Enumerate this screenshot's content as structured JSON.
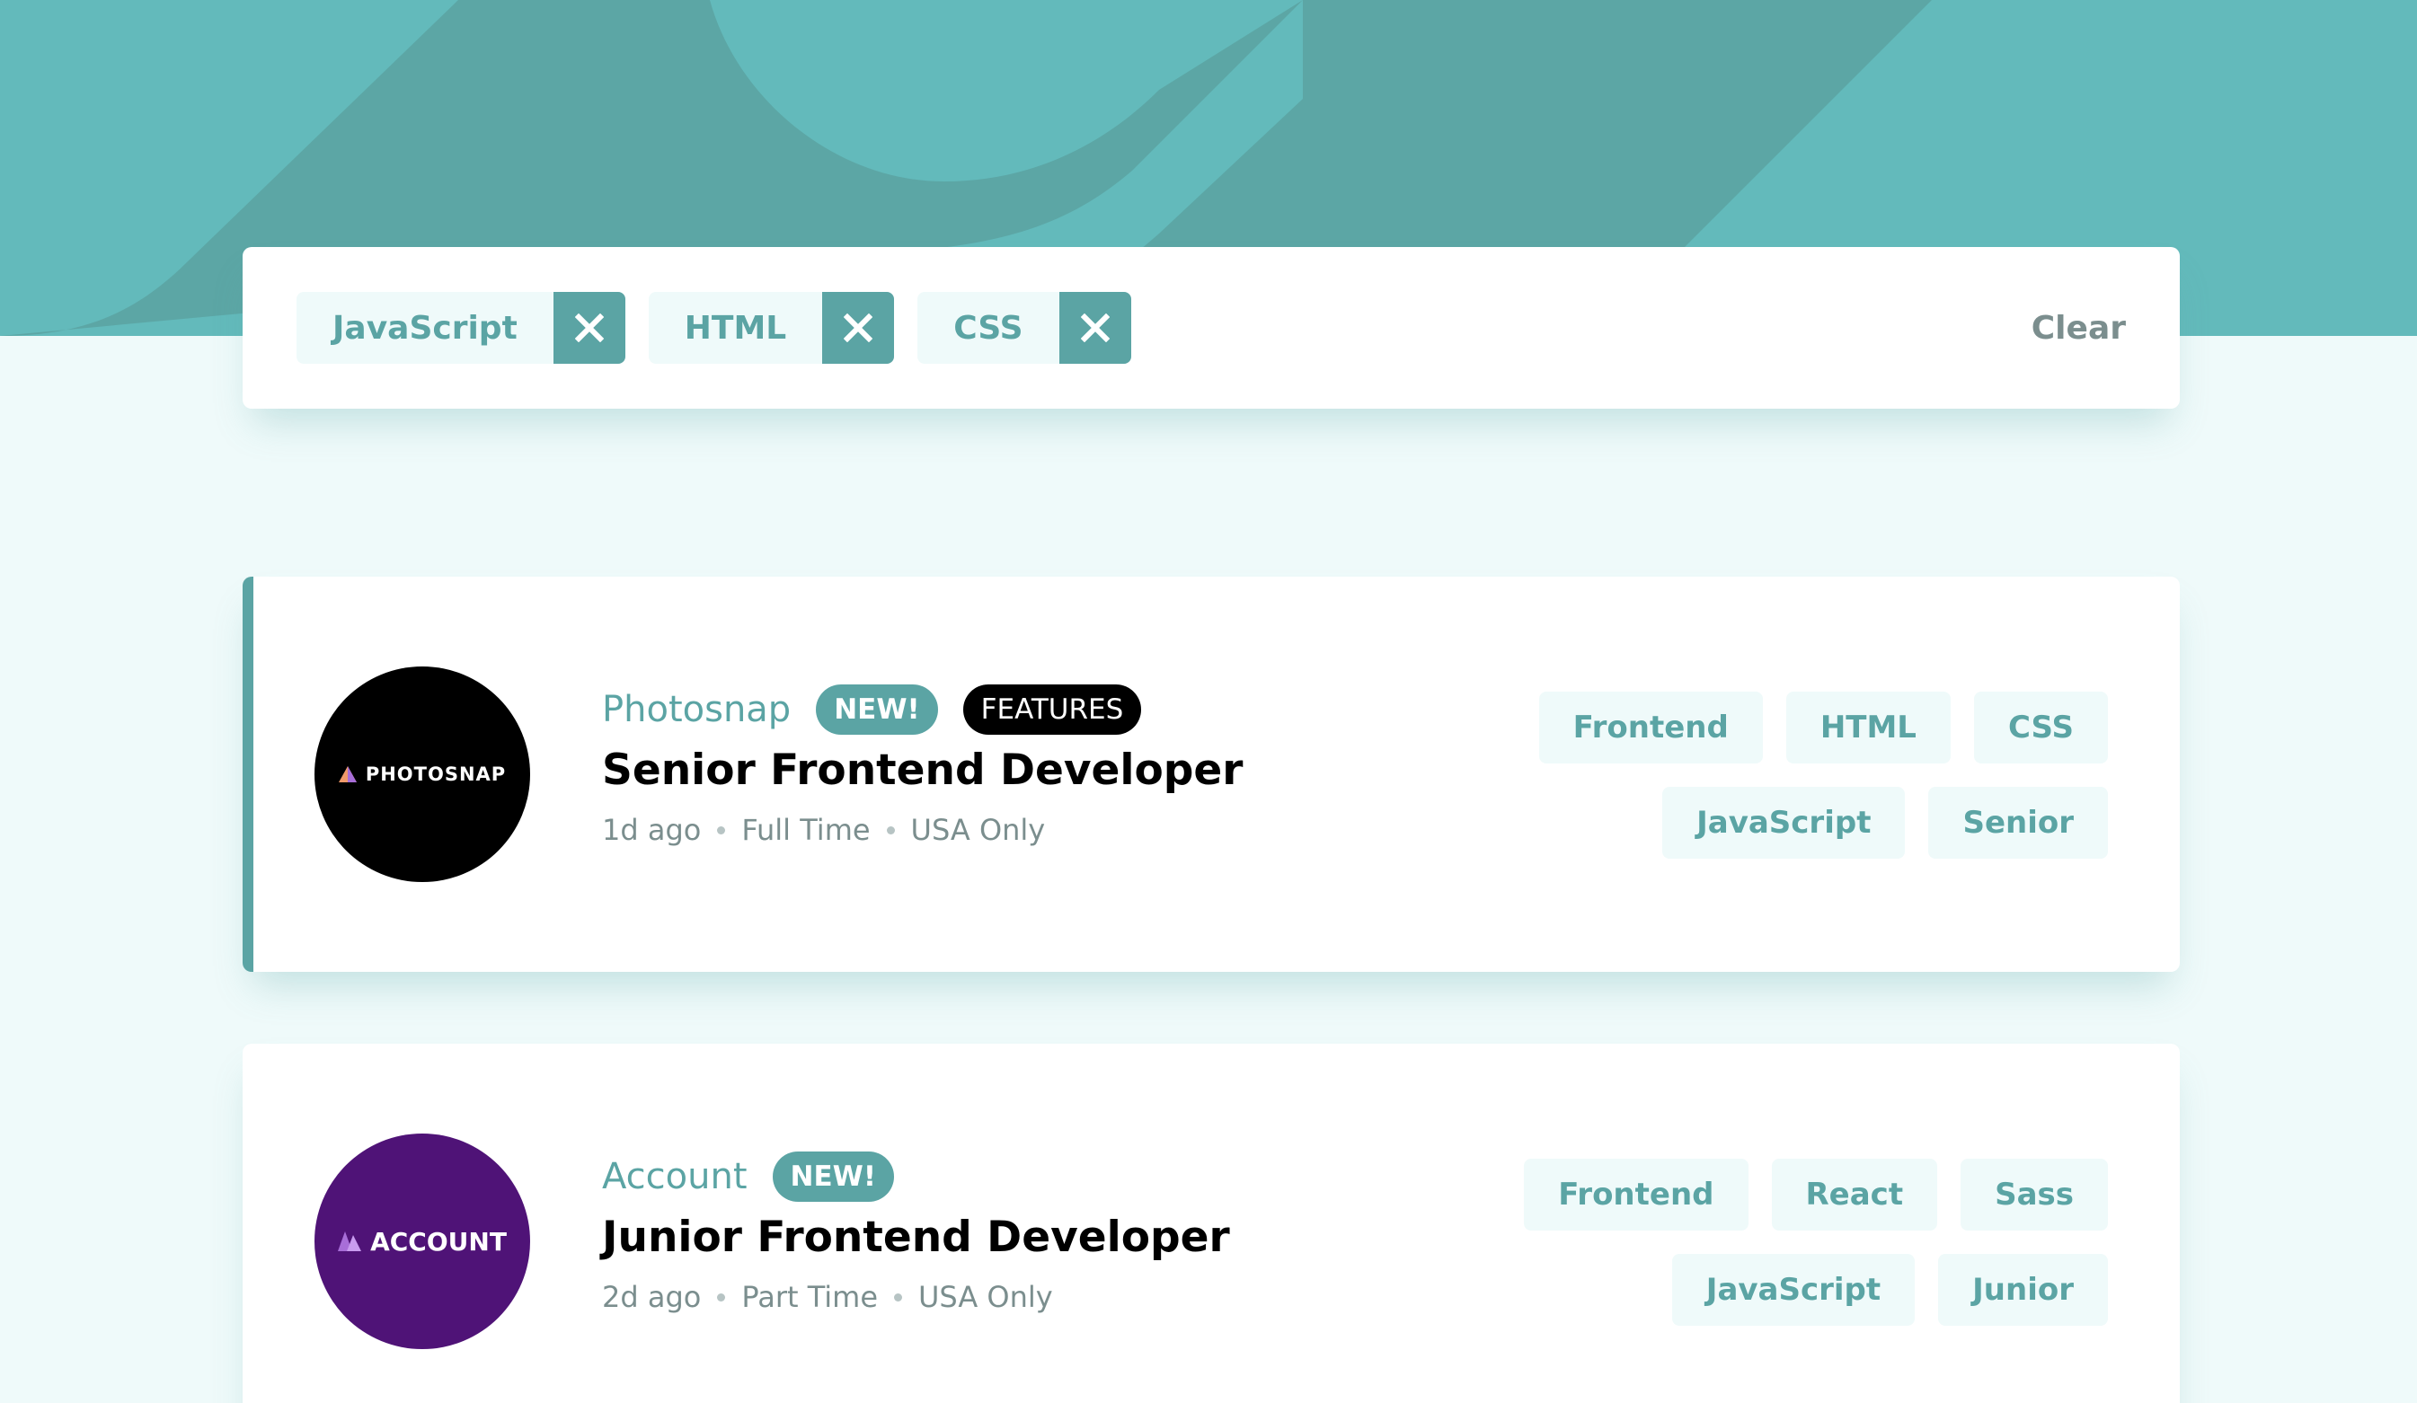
{
  "colors": {
    "primary": "#5ba4a4",
    "page_bg": "#effafa",
    "header_bg": "#5ba4a4",
    "text_dark": "#000000",
    "text_muted": "#7b8e8e"
  },
  "filter_bar": {
    "filters": [
      {
        "label": "JavaScript",
        "remove_icon": "close-icon"
      },
      {
        "label": "HTML",
        "remove_icon": "close-icon"
      },
      {
        "label": "CSS",
        "remove_icon": "close-icon"
      }
    ],
    "clear_label": "Clear"
  },
  "jobs": [
    {
      "logo_text": "PHOTOSNAP",
      "logo_icon": "triangle-mark-icon",
      "logo_color": "#000000",
      "company": "Photosnap",
      "new_label": "NEW!",
      "featured_label": "FEATURES",
      "position": "Senior Frontend Developer",
      "posted_at": "1d ago",
      "contract": "Full Time",
      "location": "USA Only",
      "tags": [
        "Frontend",
        "HTML",
        "CSS",
        "JavaScript",
        "Senior"
      ]
    },
    {
      "logo_text": "ACCOUNT",
      "logo_icon": "triangle-mark-icon",
      "logo_color": "#4f1377",
      "company": "Account",
      "new_label": "NEW!",
      "position": "Junior Frontend Developer",
      "posted_at": "2d ago",
      "contract": "Part Time",
      "location": "USA Only",
      "tags": [
        "Frontend",
        "React",
        "Sass",
        "JavaScript",
        "Junior"
      ]
    }
  ]
}
